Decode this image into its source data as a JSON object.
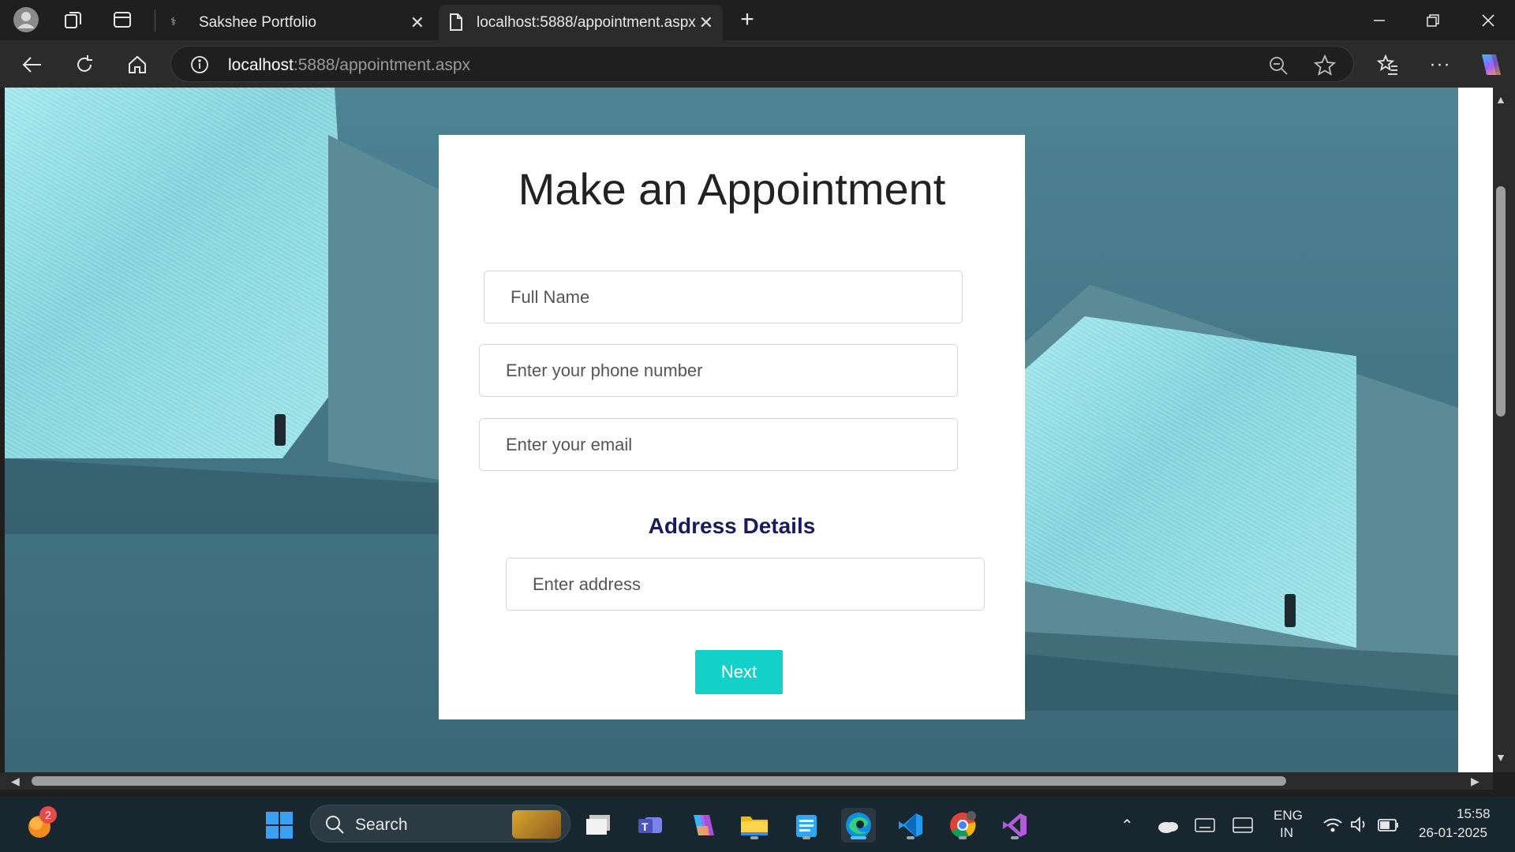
{
  "browser": {
    "tabs": [
      {
        "title": "Sakshee Portfolio",
        "active": false
      },
      {
        "title": "localhost:5888/appointment.aspx",
        "active": true
      }
    ],
    "url_host": "localhost",
    "url_rest": ":5888/appointment.aspx"
  },
  "form": {
    "title": "Make an Appointment",
    "full_name_placeholder": "Full Name",
    "phone_placeholder": "Enter your phone number",
    "email_placeholder": "Enter your email",
    "address_heading": "Address Details",
    "address_placeholder": "Enter address",
    "next_label": "Next",
    "accent_color": "#12d1c9",
    "heading_color": "#1a1a5e"
  },
  "taskbar": {
    "search_label": "Search",
    "notification_count": "2",
    "lang_line1": "ENG",
    "lang_line2": "IN",
    "time": "15:58",
    "date": "26-01-2025"
  }
}
